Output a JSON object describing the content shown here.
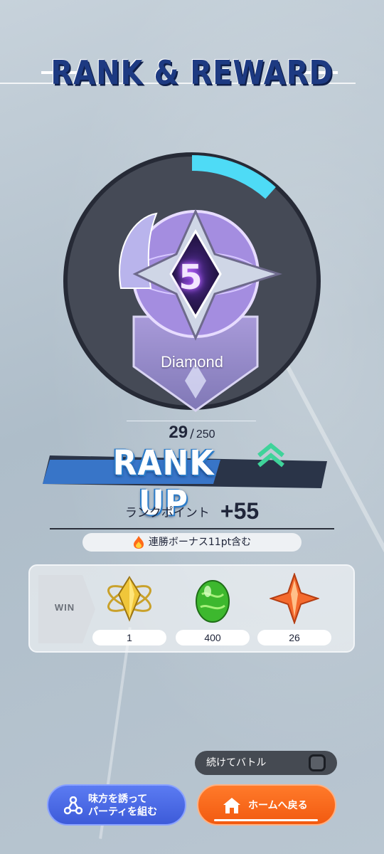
{
  "header": {
    "title": "RANK & REWARD"
  },
  "rank": {
    "tier_name": "Diamond",
    "tier_number": "5",
    "points_current": "29",
    "points_separator": "/",
    "points_max": "250",
    "progress_fraction": 0.116
  },
  "rank_up": {
    "label": "RANK UP"
  },
  "gain": {
    "label": "ランクポイント",
    "value": "+55",
    "bonus_text": "連勝ボーナス11pt含む"
  },
  "rewards": {
    "tag": "WIN",
    "items": [
      {
        "icon": "gold-crystal-icon",
        "count": "1"
      },
      {
        "icon": "green-egg-icon",
        "count": "400"
      },
      {
        "icon": "orange-star-shard-icon",
        "count": "26"
      }
    ]
  },
  "controls": {
    "continue_label": "続けてバトル",
    "continue_checked": false,
    "invite_label_line1": "味方を誘って",
    "invite_label_line2": "パーティを組む",
    "home_label": "ホームへ戻る"
  },
  "colors": {
    "accent_blue": "#3d5bd9",
    "accent_orange": "#f25a10",
    "progress_cyan": "#4fe3ff",
    "rankup_green": "#3fd39a"
  }
}
